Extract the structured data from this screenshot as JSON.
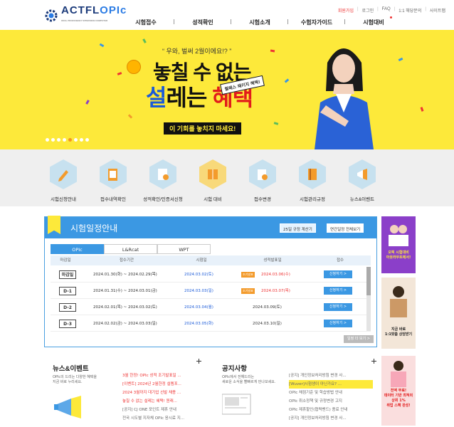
{
  "header": {
    "logo": {
      "name_part1": "ACTFL",
      "name_part2": "OPIc",
      "tagline": "ORAL PROFICIENCY INTERVIEW COMPUTER"
    },
    "util": [
      "회원가입",
      "로그인",
      "FAQ",
      "1:1 해당문의",
      "사이트맵"
    ],
    "gnb": [
      "시험접수",
      "성적확인",
      "시험소개",
      "수험자가이드",
      "시험대비"
    ]
  },
  "banner": {
    "quote": "“ 우와, 벌써 2월이에요!? ”",
    "line1": "놓칠 수 없는",
    "line2_blue": "설",
    "line2_mid": "레는 ",
    "line2_red": "혜택",
    "stamp": "월페스 패키지 혜택!",
    "tagline": "이 기회를 놓치지 마세요!",
    "dots": 8,
    "active_dot": 4
  },
  "quick": [
    {
      "label": "시험신청안내",
      "icon": "pencil-icon"
    },
    {
      "label": "접수내역확인",
      "icon": "clipboard-check-icon"
    },
    {
      "label": "성적확인/인증서신청",
      "icon": "certificate-icon"
    },
    {
      "label": "시험 대비",
      "icon": "book-icon"
    },
    {
      "label": "접수변경",
      "icon": "swap-icon"
    },
    {
      "label": "시험관리규정",
      "icon": "rulebook-icon"
    },
    {
      "label": "뉴스&이벤트",
      "icon": "megaphone-icon"
    }
  ],
  "schedule": {
    "title": "시험일정안내",
    "btn1": "25일 규정 계산기",
    "btn2": "연간일정 전체보기",
    "tabs": [
      "OPIc",
      "L&Rcat",
      "WPT"
    ],
    "columns": [
      "마감일",
      "접수기간",
      "시험일",
      "성적발표일",
      "접수"
    ],
    "rows": [
      {
        "no": "마감일",
        "period": "2024.01.30(화) ~ 2024.02.29(목)",
        "exam": "2024.03.02(토)",
        "tag": "조기발표",
        "result": "2024.03.06(수)",
        "apply": "신청하기 >"
      },
      {
        "no": "D-1",
        "period": "2024.01.31(수) ~ 2024.03.01(금)",
        "exam": "2024.03.03(일)",
        "tag": "조기발표",
        "result": "2024.03.07(목)",
        "apply": "신청하기 >"
      },
      {
        "no": "D-2",
        "period": "2024.02.01(목) ~ 2024.03.02(토)",
        "exam": "2024.03.04(월)",
        "tag": "",
        "result": "2024.03.09(토)",
        "apply": "신청하기 >"
      },
      {
        "no": "D-3",
        "period": "2024.02.02(금) ~ 2024.03.03(일)",
        "exam": "2024.03.05(화)",
        "tag": "",
        "result": "2024.03.10(일)",
        "apply": "신청하기 >"
      }
    ],
    "more": "일정 더 보기 >"
  },
  "side": {
    "b1": "오픽 시험대비\n아웃라우트에서!",
    "b2": "지금 바로\n1:1맞춤 상담받기",
    "b3": "전액 무료!\n데이터 기반 최적의\n상위 1%\n취업 스펙 완성!"
  },
  "news": {
    "title": "뉴스&이벤트",
    "sub": "OPIc의 드리는 다양한 혜택을\n지금 바로 누리세요.",
    "items": [
      "3월 한정! OPIc 성적 조기발표일 ...",
      "[이벤트] 2024년 2월한정 설렘포...",
      "2024 3월까지 대기업 선발 채용 ...",
      "놓칠 수 없는 설레는 혜택! 원래...",
      "[공지] CJ ONE 포인트 제휴 안내",
      "전국 시도별 지자체 OPIc 응시료 지..."
    ]
  },
  "notice": {
    "title": "공지사항",
    "sub": "OPIc에서 전해드리는\n새로운 소식을 빨빠르게 만나보세요.",
    "items": [
      "[공지] 개인정보처리방침 변경 사...",
      "[Wuver]시험생이 아닌가요? ...",
      "OPIc 채점기준 및 학습방법 안내",
      "OPIc 취소정책 및 규정변경 고지",
      "OPIc 제휴할인(협력밴드) 종료 안내",
      "[공지] 개인정보처리방침 변경 사..."
    ]
  }
}
